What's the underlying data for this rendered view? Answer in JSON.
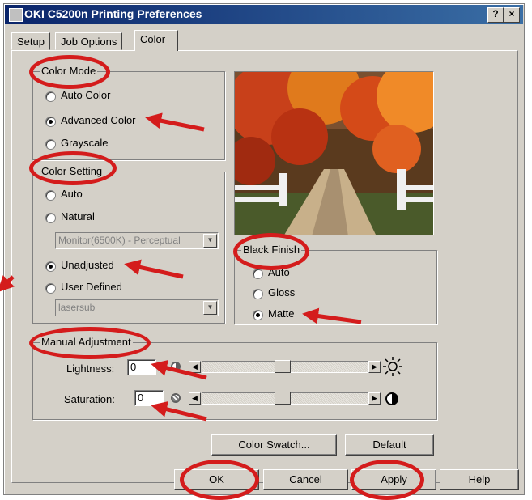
{
  "window": {
    "title": "OKI C5200n Printing Preferences",
    "help_button": "?",
    "close_button": "×"
  },
  "tabs": [
    {
      "label": "Setup"
    },
    {
      "label": "Job Options"
    },
    {
      "label": "Color"
    }
  ],
  "color_mode": {
    "label": "Color Mode",
    "options": [
      "Auto Color",
      "Advanced Color",
      "Grayscale"
    ],
    "selected": "Advanced Color"
  },
  "color_setting": {
    "label": "Color Setting",
    "options": [
      "Auto",
      "Natural",
      "Unadjusted",
      "User Defined"
    ],
    "selected": "Unadjusted",
    "natural_profile": "Monitor(6500K) - Perceptual",
    "user_profile": "lasersub"
  },
  "black_finish": {
    "label": "Black Finish",
    "options": [
      "Auto",
      "Gloss",
      "Matte"
    ],
    "selected": "Matte"
  },
  "manual_adjustment": {
    "label": "Manual Adjustment",
    "lightness_label": "Lightness:",
    "lightness_value": "0",
    "saturation_label": "Saturation:",
    "saturation_value": "0"
  },
  "buttons": {
    "color_swatch": "Color Swatch...",
    "default": "Default",
    "ok": "OK",
    "cancel": "Cancel",
    "apply": "Apply",
    "help": "Help"
  },
  "colors": {
    "annotation": "#d41c1c",
    "titlebar": "#0a246a",
    "dialog": "#d4d0c8"
  },
  "icons": [
    "printer-icon",
    "sun-icon",
    "contrast-icon"
  ]
}
